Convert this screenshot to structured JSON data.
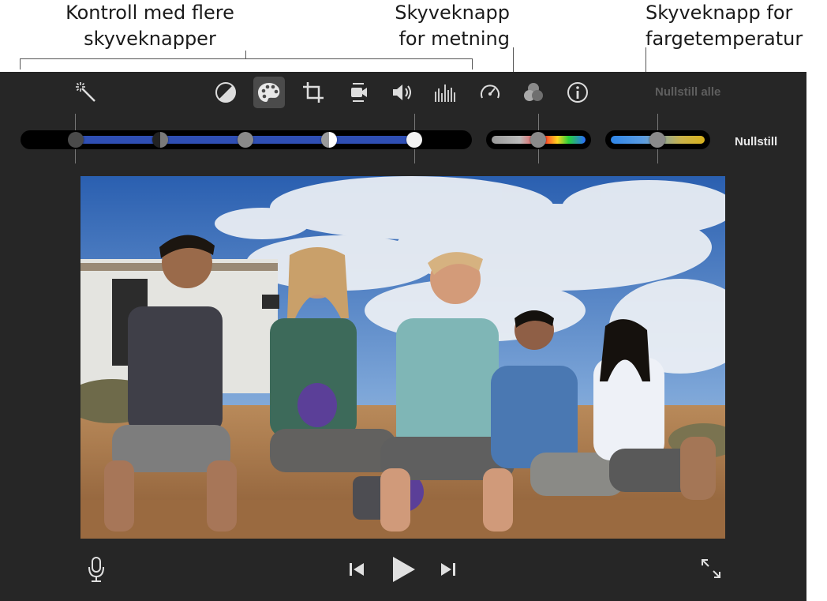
{
  "callouts": {
    "multi_slider": [
      "Kontroll med flere",
      "skyveknapper"
    ],
    "saturation": [
      "Skyveknapp",
      "for metning"
    ],
    "temperature": [
      "Skyveknapp for",
      "fargetemperatur"
    ]
  },
  "toolbar": {
    "icons": [
      "magic-wand-icon",
      "color-balance-icon",
      "color-correction-icon",
      "crop-icon",
      "stabilization-icon",
      "volume-icon",
      "equalizer-icon",
      "speed-icon",
      "filter-icon",
      "info-icon"
    ],
    "active": "color-correction-icon",
    "reset_all_label": "Nullstill alle"
  },
  "controls": {
    "reset_label": "Nullstill",
    "multi_slider": {
      "knob_count": 5
    },
    "saturation": {
      "gradient": [
        "#9a9a9a",
        "#ff2b2b",
        "#ffd21f",
        "#28d03b",
        "#2a6cff"
      ]
    },
    "temperature": {
      "gradient": [
        "#2f86e8",
        "#d8b21e"
      ]
    }
  },
  "player": {
    "mic": "microphone-icon",
    "prev": "skip-back-icon",
    "play": "play-icon",
    "next": "skip-forward-icon",
    "fullscreen": "fullscreen-icon"
  },
  "colors": {
    "panel": "#262626",
    "slider_blue": "#2f4fb4"
  }
}
